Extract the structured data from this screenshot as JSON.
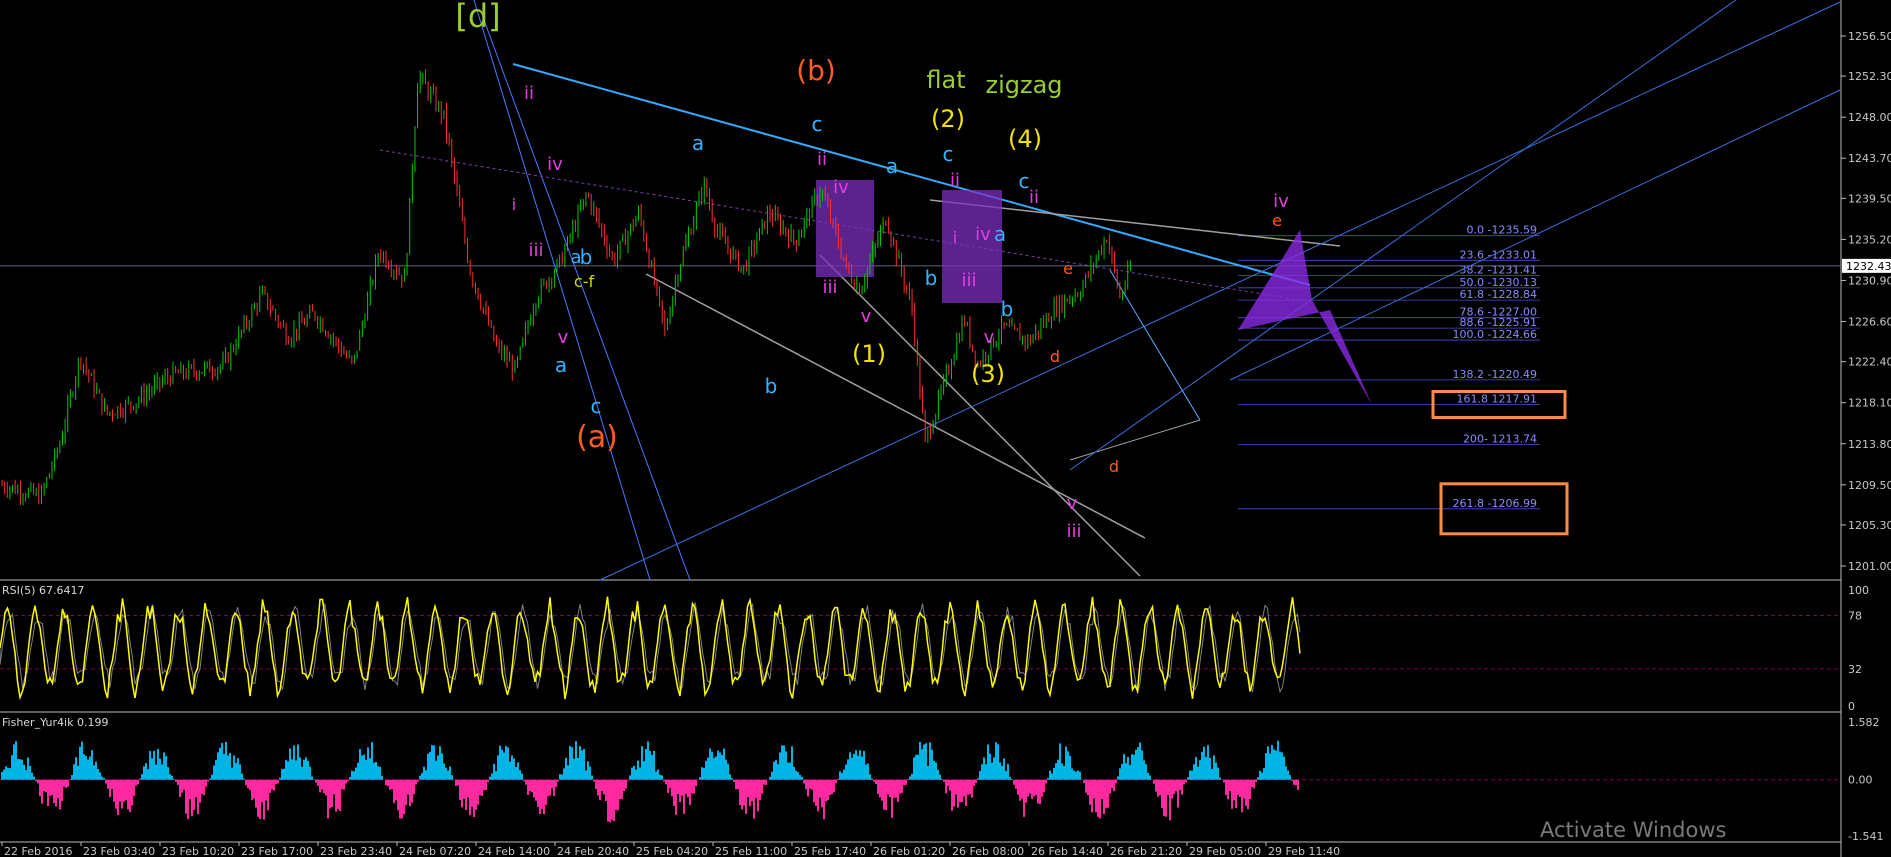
{
  "chart_data": [
    {
      "type": "line",
      "title": "",
      "style": "candlestick",
      "y_ticks": [
        "1256.50",
        "1252.30",
        "1248.00",
        "1243.70",
        "1239.50",
        "1235.20",
        "1230.90",
        "1226.60",
        "1222.40",
        "1218.10",
        "1213.80",
        "1209.50",
        "1205.30",
        "1201.00"
      ],
      "ylim": [
        1201.0,
        1256.5
      ],
      "x_ticks": [
        "22 Feb 2016",
        "23 Feb 03:40",
        "23 Feb 10:20",
        "23 Feb 17:00",
        "23 Feb 23:40",
        "24 Feb 07:20",
        "24 Feb 14:00",
        "24 Feb 20:40",
        "25 Feb 04:20",
        "25 Feb 11:00",
        "25 Feb 17:40",
        "26 Feb 01:20",
        "26 Feb 08:00",
        "26 Feb 14:40",
        "26 Feb 21:20",
        "29 Feb 05:00",
        "29 Feb 11:40"
      ],
      "current_price": "1232.43",
      "fib_levels": [
        {
          "label": "0.0 -1235.59",
          "value": 1235.59
        },
        {
          "label": "23.6 -1233.01",
          "value": 1233.01
        },
        {
          "label": "38.2 -1231.41",
          "value": 1231.41
        },
        {
          "label": "50.0 -1230.13",
          "value": 1230.13
        },
        {
          "label": "61.8 -1228.84",
          "value": 1228.84
        },
        {
          "label": "78.6 -1227.00",
          "value": 1227.0
        },
        {
          "label": "88.6 -1225.91",
          "value": 1225.91
        },
        {
          "label": "100.0 -1224.66",
          "value": 1224.66
        },
        {
          "label": "138.2 -1220.49",
          "value": 1220.49
        },
        {
          "label": "161.8 1217.91",
          "value": 1217.91
        },
        {
          "label": "200- 1213.74",
          "value": 1213.74
        },
        {
          "label": "261.8 -1206.99",
          "value": 1206.99
        }
      ],
      "wave_labels": [
        {
          "text": "[d]",
          "color": "#9acd32"
        },
        {
          "text": "(b)",
          "color": "#ff5a1f"
        },
        {
          "text": "flat",
          "color": "#9acd32"
        },
        {
          "text": "zigzag",
          "color": "#9acd32"
        },
        {
          "text": "(2)",
          "color": "#f2e200"
        },
        {
          "text": "(4)",
          "color": "#f2e200"
        },
        {
          "text": "(1)",
          "color": "#f2e200"
        },
        {
          "text": "(3)",
          "color": "#f2e200"
        },
        {
          "text": "(a)",
          "color": "#ff5a1f"
        },
        {
          "text": "c",
          "color": "#33b5ff"
        },
        {
          "text": "a",
          "color": "#33b5ff"
        },
        {
          "text": "b",
          "color": "#33b5ff"
        },
        {
          "text": "ii",
          "color": "#e040e0"
        },
        {
          "text": "iii",
          "color": "#e040e0"
        },
        {
          "text": "iv",
          "color": "#e040e0"
        },
        {
          "text": "v",
          "color": "#e040e0"
        },
        {
          "text": "i",
          "color": "#e040e0"
        },
        {
          "text": "c-f",
          "color": "#d8d800"
        },
        {
          "text": "d",
          "color": "#ff5a1f"
        },
        {
          "text": "e",
          "color": "#ff5a1f"
        }
      ]
    },
    {
      "type": "line",
      "title": "RSI(5) 67.6417",
      "y_ticks": [
        "100",
        "78",
        "32",
        "0"
      ],
      "ylim": [
        0,
        100
      ]
    },
    {
      "type": "bar",
      "title": "Fisher_Yur4ik 0.199",
      "y_ticks": [
        "1.582",
        "0.00",
        "-1.541"
      ],
      "ylim": [
        -1.541,
        1.582
      ]
    }
  ],
  "watermark": "Activate Windows",
  "colors": {
    "background": "#000000",
    "bull_candle": "#00c800",
    "bear_candle": "#ff3030",
    "trendline_blue": "#3399ff",
    "trendline_gray": "#a0a0a0",
    "rsi": "#ffff00",
    "fisher_pos": "#00b4e6",
    "fisher_neg": "#ff2aa0",
    "purple_box": "#7b2fbe",
    "fib_box": "#ff8c42"
  }
}
